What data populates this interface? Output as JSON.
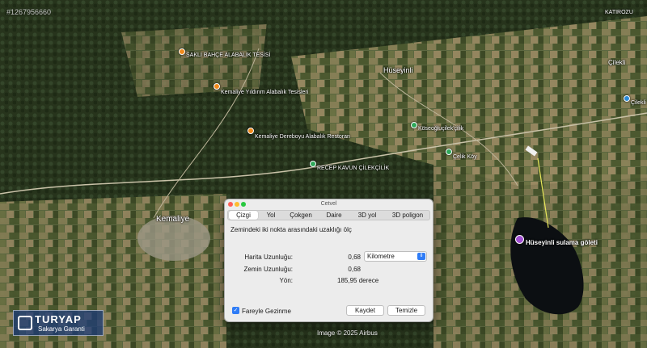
{
  "map": {
    "watermark_id": "#1267956660",
    "attribution": "Image © 2025 Airbus",
    "places": {
      "katirozu": "KATIROZU",
      "cilekli_top": "Çilekli",
      "cilekli_right": "Çilekli",
      "huseyinli": "Hüseyinli",
      "kemaliye": "Kemaliye",
      "sakli_bahce": "SAKLI BAHÇE ALABALIK TESİSİ",
      "yildirim": "Kemaliye Yıldırım Alabalık Tesisleri",
      "dereboyu": "Kemaliye Dereboyu Alabalık Restoran",
      "kosecilik": "Köseoğluçilek'çilik",
      "celik_koy": "Çelik Köy",
      "recep": "RECEP KAVUN ÇİLEKÇİLİK",
      "pond": "Hüseyinli sulama göleti"
    }
  },
  "logo": {
    "brand": "TURYAP",
    "sub": "Sakarya Garanti"
  },
  "window": {
    "title": "Cetvel",
    "tabs": [
      "Çizgi",
      "Yol",
      "Çokgen",
      "Daire",
      "3D yol",
      "3D poligon"
    ],
    "active_tab": "Çizgi",
    "description": "Zemindeki iki nokta arasındaki uzaklığı ölç",
    "map_length_label": "Harita Uzunluğu:",
    "map_length_value": "0,68",
    "ground_length_label": "Zemin Uzunluğu:",
    "ground_length_value": "0,68",
    "heading_label": "Yön:",
    "heading_value": "185,95 derece",
    "unit": "Kilometre",
    "mouse_nav_label": "Fareyle Gezinme",
    "mouse_nav_checked": true,
    "save_label": "Kaydet",
    "clear_label": "Temizle"
  }
}
